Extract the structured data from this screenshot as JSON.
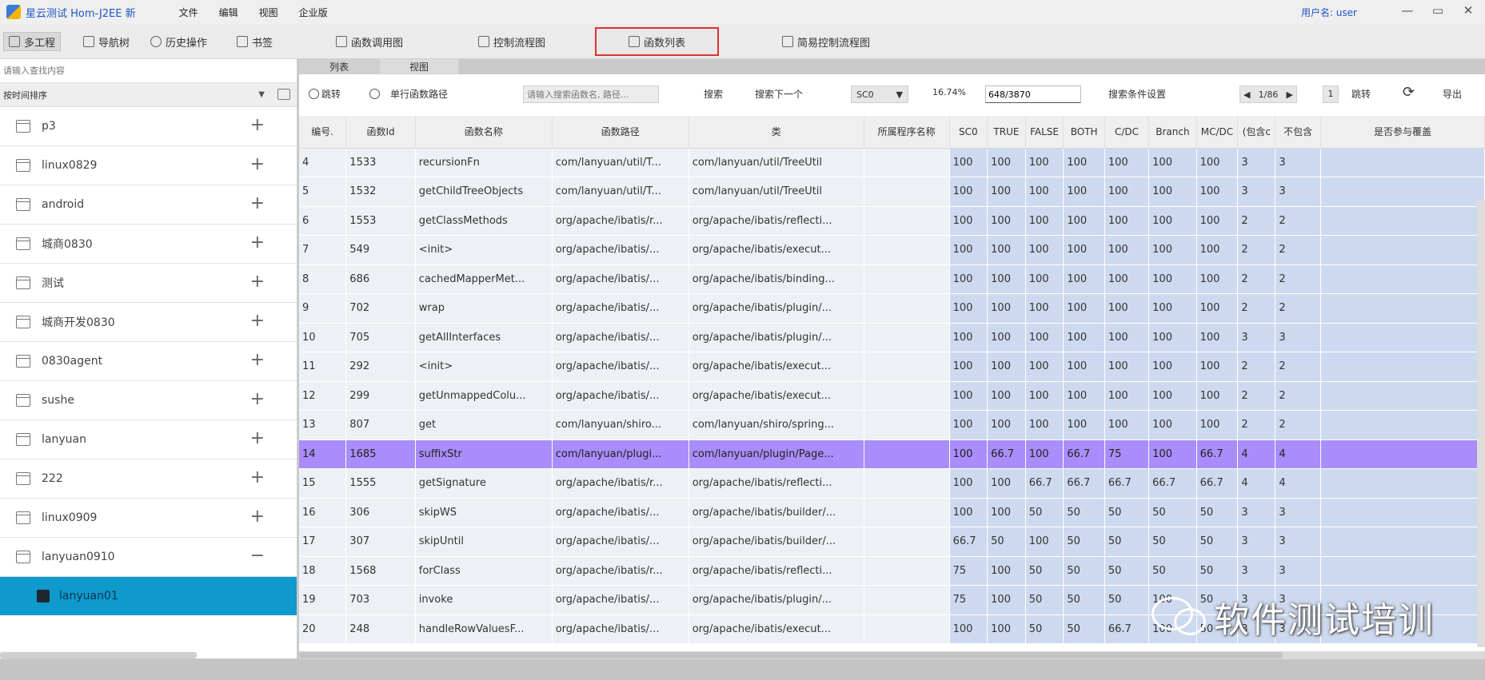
{
  "window": {
    "title": "星云测试 Hom-J2EE 新",
    "menu": [
      "文件",
      "编辑",
      "视图",
      "企业版"
    ],
    "user": "用户名: user",
    "controls": [
      "—",
      "▭",
      "✕"
    ]
  },
  "toolbar": {
    "left": [
      {
        "label": "多工程",
        "icon": "project-icon"
      },
      {
        "label": "导航树",
        "icon": "tree-icon"
      },
      {
        "label": "历史操作",
        "icon": "history-icon"
      },
      {
        "label": "书签",
        "icon": "bookmark-icon"
      }
    ],
    "views": [
      {
        "label": "函数调用图",
        "icon": "call-graph-icon"
      },
      {
        "label": "控制流程图",
        "icon": "flowchart-icon"
      },
      {
        "label": "函数列表",
        "icon": "function-list-icon",
        "highlighted": true
      },
      {
        "label": "简易控制流程图",
        "icon": "simple-flowchart-icon"
      }
    ]
  },
  "subtabs": [
    "列表",
    "视图"
  ],
  "sidebar": {
    "search_placeholder": "请输入查找内容",
    "sort_label": "按时间排序",
    "projects": [
      {
        "name": "p3",
        "expanded": false
      },
      {
        "name": "linux0829",
        "expanded": false
      },
      {
        "name": "android",
        "expanded": false
      },
      {
        "name": "城商0830",
        "expanded": false
      },
      {
        "name": "测试",
        "expanded": false
      },
      {
        "name": "城商开发0830",
        "expanded": false
      },
      {
        "name": "0830agent",
        "expanded": false
      },
      {
        "name": "sushe",
        "expanded": false
      },
      {
        "name": "lanyuan",
        "expanded": false
      },
      {
        "name": "222",
        "expanded": false
      },
      {
        "name": "linux0909",
        "expanded": false
      },
      {
        "name": "lanyuan0910",
        "expanded": true
      }
    ],
    "selected_child": "lanyuan01"
  },
  "search": {
    "radio_jump": "跳转",
    "radio_single": "单行函数路径",
    "placeholder": "请输入搜索函数名, 路径...",
    "search_btn": "搜索",
    "next_btn": "搜索下一个",
    "metric": "SC0",
    "percent": "16.74%",
    "count": "648/3870",
    "cond_btn": "搜索条件设置",
    "page": "1/86",
    "page_input": "1",
    "jump_btn": "跳转",
    "export_btn": "导出"
  },
  "table": {
    "columns": [
      "编号.",
      "函数Id",
      "函数名称",
      "函数路径",
      "类",
      "所属程序名称",
      "SC0",
      "TRUE",
      "FALSE",
      "BOTH",
      "C/DC",
      "Branch",
      "MC/DC",
      "(包含c",
      "不包含",
      "是否参与覆盖"
    ],
    "rows": [
      [
        "4",
        "1533",
        "recursionFn",
        "com/lanyuan/util/T...",
        "com/lanyuan/util/TreeUtil",
        "",
        "100",
        "100",
        "100",
        "100",
        "100",
        "100",
        "100",
        "3",
        "3",
        ""
      ],
      [
        "5",
        "1532",
        "getChildTreeObjects",
        "com/lanyuan/util/T...",
        "com/lanyuan/util/TreeUtil",
        "",
        "100",
        "100",
        "100",
        "100",
        "100",
        "100",
        "100",
        "3",
        "3",
        ""
      ],
      [
        "6",
        "1553",
        "getClassMethods",
        "org/apache/ibatis/r...",
        "org/apache/ibatis/reflecti...",
        "",
        "100",
        "100",
        "100",
        "100",
        "100",
        "100",
        "100",
        "2",
        "2",
        ""
      ],
      [
        "7",
        "549",
        "<init>",
        "org/apache/ibatis/...",
        "org/apache/ibatis/execut...",
        "",
        "100",
        "100",
        "100",
        "100",
        "100",
        "100",
        "100",
        "2",
        "2",
        ""
      ],
      [
        "8",
        "686",
        "cachedMapperMet...",
        "org/apache/ibatis/...",
        "org/apache/ibatis/binding...",
        "",
        "100",
        "100",
        "100",
        "100",
        "100",
        "100",
        "100",
        "2",
        "2",
        ""
      ],
      [
        "9",
        "702",
        "wrap",
        "org/apache/ibatis/...",
        "org/apache/ibatis/plugin/...",
        "",
        "100",
        "100",
        "100",
        "100",
        "100",
        "100",
        "100",
        "2",
        "2",
        ""
      ],
      [
        "10",
        "705",
        "getAllInterfaces",
        "org/apache/ibatis/...",
        "org/apache/ibatis/plugin/...",
        "",
        "100",
        "100",
        "100",
        "100",
        "100",
        "100",
        "100",
        "3",
        "3",
        ""
      ],
      [
        "11",
        "292",
        "<init>",
        "org/apache/ibatis/...",
        "org/apache/ibatis/execut...",
        "",
        "100",
        "100",
        "100",
        "100",
        "100",
        "100",
        "100",
        "2",
        "2",
        ""
      ],
      [
        "12",
        "299",
        "getUnmappedColu...",
        "org/apache/ibatis/...",
        "org/apache/ibatis/execut...",
        "",
        "100",
        "100",
        "100",
        "100",
        "100",
        "100",
        "100",
        "2",
        "2",
        ""
      ],
      [
        "13",
        "807",
        "get",
        "com/lanyuan/shiro...",
        "com/lanyuan/shiro/spring...",
        "",
        "100",
        "100",
        "100",
        "100",
        "100",
        "100",
        "100",
        "2",
        "2",
        ""
      ],
      [
        "14",
        "1685",
        "suffixStr",
        "com/lanyuan/plugi...",
        "com/lanyuan/plugin/Page...",
        "",
        "100",
        "66.7",
        "100",
        "66.7",
        "75",
        "100",
        "66.7",
        "4",
        "4",
        ""
      ],
      [
        "15",
        "1555",
        "getSignature",
        "org/apache/ibatis/r...",
        "org/apache/ibatis/reflecti...",
        "",
        "100",
        "100",
        "66.7",
        "66.7",
        "66.7",
        "66.7",
        "66.7",
        "4",
        "4",
        ""
      ],
      [
        "16",
        "306",
        "skipWS",
        "org/apache/ibatis/...",
        "org/apache/ibatis/builder/...",
        "",
        "100",
        "100",
        "50",
        "50",
        "50",
        "50",
        "50",
        "3",
        "3",
        ""
      ],
      [
        "17",
        "307",
        "skipUntil",
        "org/apache/ibatis/...",
        "org/apache/ibatis/builder/...",
        "",
        "66.7",
        "50",
        "100",
        "50",
        "50",
        "50",
        "50",
        "3",
        "3",
        ""
      ],
      [
        "18",
        "1568",
        "forClass",
        "org/apache/ibatis/r...",
        "org/apache/ibatis/reflecti...",
        "",
        "75",
        "100",
        "50",
        "50",
        "50",
        "50",
        "50",
        "3",
        "3",
        ""
      ],
      [
        "19",
        "703",
        "invoke",
        "org/apache/ibatis/...",
        "org/apache/ibatis/plugin/...",
        "",
        "75",
        "100",
        "50",
        "50",
        "50",
        "100",
        "50",
        "3",
        "3",
        ""
      ],
      [
        "20",
        "248",
        "handleRowValuesF...",
        "org/apache/ibatis/...",
        "org/apache/ibatis/execut...",
        "",
        "100",
        "100",
        "50",
        "50",
        "66.7",
        "100",
        "50",
        "3",
        "3",
        ""
      ]
    ],
    "selected_row": 10
  },
  "watermark": "软件测试培训"
}
